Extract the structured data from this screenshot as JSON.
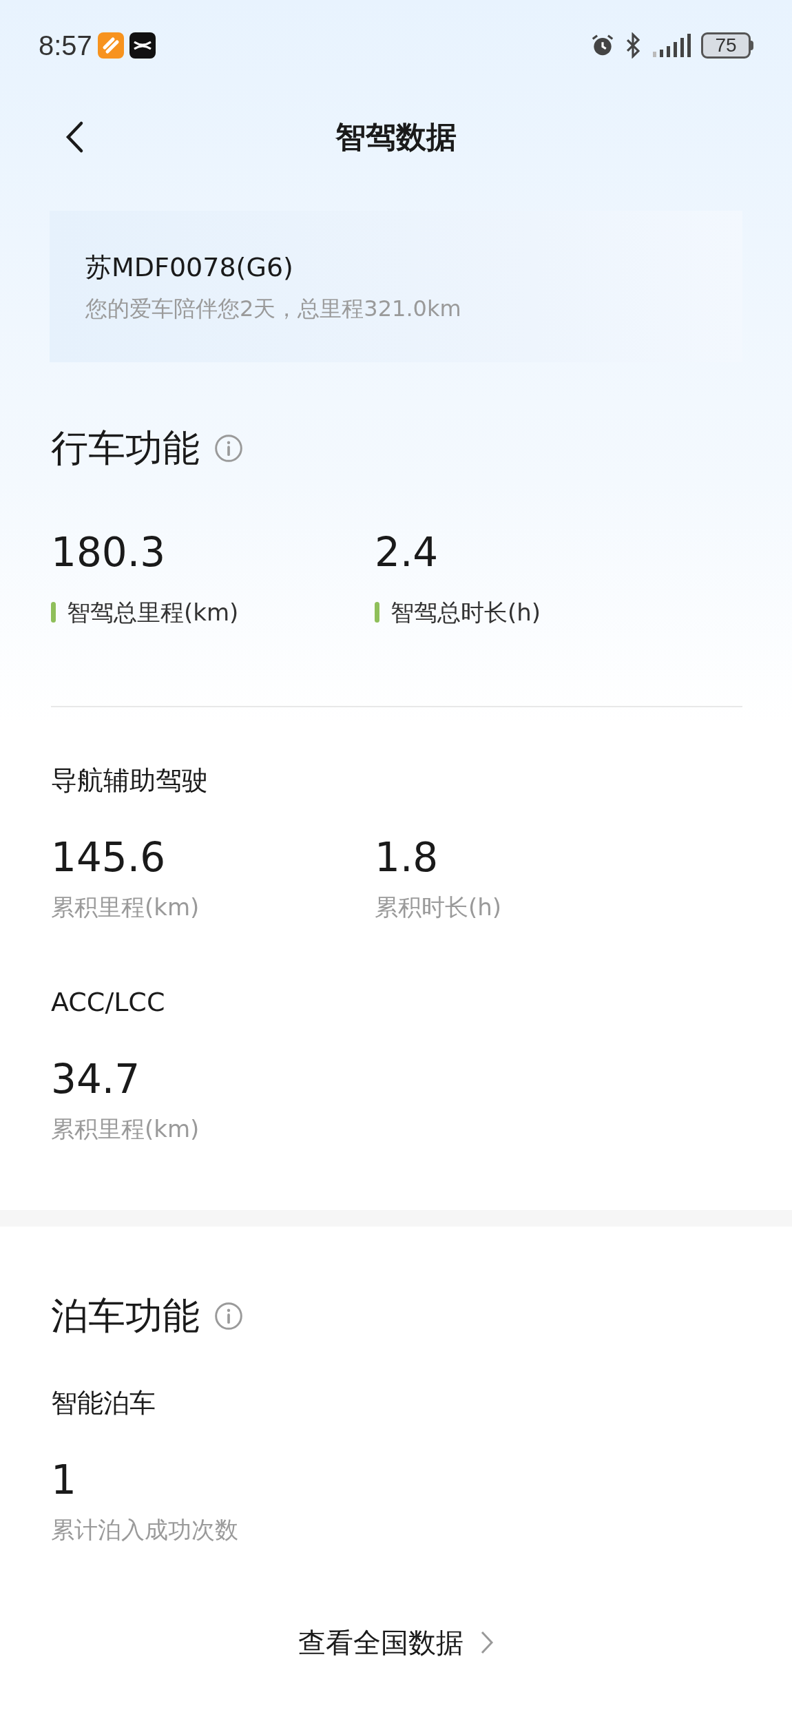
{
  "status_bar": {
    "time": "8:57",
    "battery": "75"
  },
  "header": {
    "title": "智驾数据"
  },
  "vehicle_card": {
    "name": "苏MDF0078(G6)",
    "summary": "您的爱车陪伴您2天，总里程321.0km"
  },
  "sections": [
    {
      "title": "行车功能",
      "highlights": [
        {
          "value": "180.3",
          "label": "智驾总里程(km)"
        },
        {
          "value": "2.4",
          "label": "智驾总时长(h)"
        }
      ],
      "groups": [
        {
          "title": "导航辅助驾驶",
          "metrics": [
            {
              "value": "145.6",
              "label": "累积里程(km)"
            },
            {
              "value": "1.8",
              "label": "累积时长(h)"
            }
          ]
        },
        {
          "title": "ACC/LCC",
          "metrics": [
            {
              "value": "34.7",
              "label": "累积里程(km)"
            }
          ]
        }
      ]
    },
    {
      "title": "泊车功能",
      "groups": [
        {
          "title": "智能泊车",
          "metrics": [
            {
              "value": "1",
              "label": "累计泊入成功次数"
            }
          ]
        }
      ]
    }
  ],
  "footer_link": "查看全国数据"
}
